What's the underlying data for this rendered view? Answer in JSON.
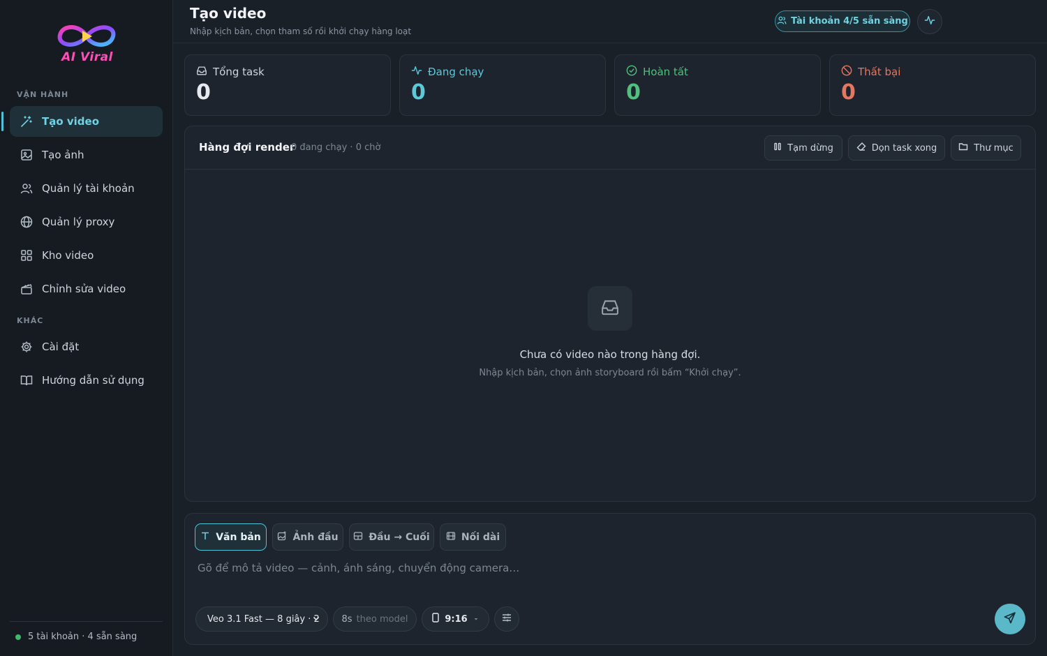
{
  "brand": {
    "logo_text": "AI Viral"
  },
  "sidebar": {
    "section_ops": "VẬN HÀNH",
    "section_other": "KHÁC",
    "items": [
      {
        "label": "Tạo video",
        "icon": "magic-wand-icon"
      },
      {
        "label": "Tạo ảnh",
        "icon": "image-icon"
      },
      {
        "label": "Quản lý tài khoản",
        "icon": "users-icon"
      },
      {
        "label": "Quản lý proxy",
        "icon": "globe-icon"
      },
      {
        "label": "Kho video",
        "icon": "grid-icon"
      },
      {
        "label": "Chỉnh sửa video",
        "icon": "clapperboard-icon"
      },
      {
        "label": "Cài đặt",
        "icon": "gear-icon"
      },
      {
        "label": "Hướng dẫn sử dụng",
        "icon": "book-icon"
      }
    ],
    "footer_status": "5 tài khoản · 4 sẵn sàng"
  },
  "header": {
    "title": "Tạo video",
    "subtitle": "Nhập kịch bản, chọn tham số rồi khởi chạy hàng loạt",
    "account_pill": "Tài khoản 4/5 sẵn sàng"
  },
  "stats": [
    {
      "label": "Tổng task",
      "value": "0",
      "color": "#e6e9ee"
    },
    {
      "label": "Đang chạy",
      "value": "0",
      "color": "#5cc8da"
    },
    {
      "label": "Hoàn tất",
      "value": "0",
      "color": "#4fc07f"
    },
    {
      "label": "Thất bại",
      "value": "0",
      "color": "#e5765f"
    }
  ],
  "queue": {
    "title": "Hàng đợi render",
    "meta": "0 đang chạy · 0 chờ",
    "pause_label": "Tạm dừng",
    "clean_label": "Dọn task xong",
    "folder_label": "Thư mục",
    "empty_title": "Chưa có video nào trong hàng đợi.",
    "empty_sub": "Nhập kịch bản, chọn ảnh storyboard rồi bấm “Khởi chạy”."
  },
  "composer": {
    "modes": [
      "Văn bản",
      "Ảnh đầu",
      "Đầu → Cuối",
      "Nối dài"
    ],
    "placeholder": "Gõ để mô tả video — cảnh, ánh sáng, chuyển động camera…",
    "model": "Veo 3.1 Fast — 8 giây · 2",
    "duration_value": "8s",
    "duration_note": "theo model",
    "ratio": "9:16"
  },
  "colors": {
    "accent": "#4fc3d6",
    "bg": "#1a2028",
    "panel": "#1d242d"
  }
}
